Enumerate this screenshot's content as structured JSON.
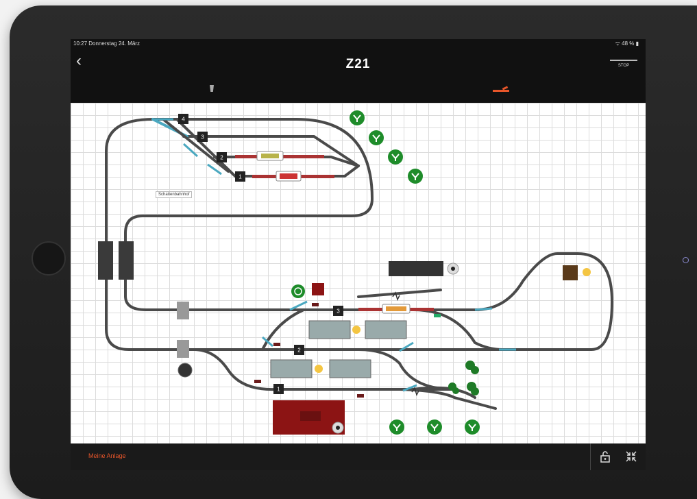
{
  "status": {
    "time": "10:27",
    "date": "Donnerstag 24. März",
    "battery": "48 %"
  },
  "header": {
    "back_icon": "chevron-left-icon",
    "title": "Z21",
    "stop_label": "STOP"
  },
  "mode_icons": [
    "locomotive-icon",
    "track-icon"
  ],
  "layout": {
    "station_label": "Schattenbahnhof",
    "track_numbers": [
      "4",
      "3",
      "2",
      "1",
      "3",
      "2",
      "1"
    ]
  },
  "footer": {
    "layout_name": "Meine Anlage",
    "lock_icon": "lock-icon",
    "collapse_icon": "collapse-icon"
  },
  "colors": {
    "track": "#4a4a4a",
    "switch": "#4aa8c0",
    "accent": "#e8562a",
    "signal_green": "#1e8c2a",
    "building_red": "#8c1414"
  }
}
